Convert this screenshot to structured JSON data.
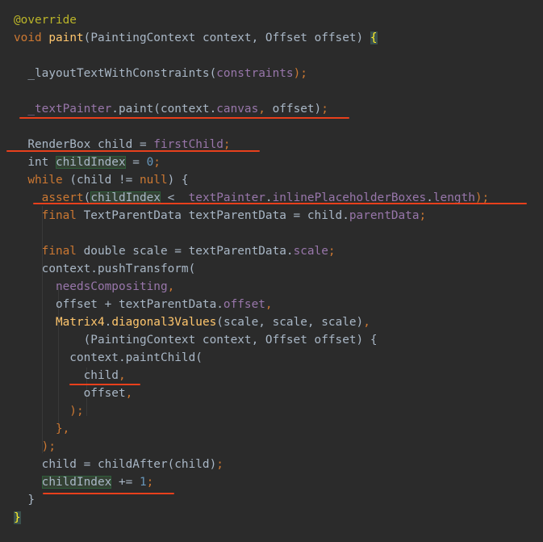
{
  "editor": {
    "lines": [
      {
        "tokens": [
          {
            "t": "@override",
            "c": "ann"
          }
        ]
      },
      {
        "tokens": [
          {
            "t": "void ",
            "c": "kw"
          },
          {
            "t": "paint",
            "c": "fn"
          },
          {
            "t": "(PaintingContext context, Offset offset) ",
            "c": "plain"
          },
          {
            "t": "{",
            "c": "brace"
          }
        ]
      },
      {
        "tokens": []
      },
      {
        "tokens": [
          {
            "t": "  _layoutTextWithConstraints(",
            "c": "plain"
          },
          {
            "t": "constraints",
            "c": "field"
          },
          {
            "t": ");",
            "c": "kw"
          }
        ]
      },
      {
        "tokens": []
      },
      {
        "tokens": [
          {
            "t": "  ",
            "c": "plain"
          },
          {
            "t": "_textPainter",
            "c": "tp"
          },
          {
            "t": ".paint(context.",
            "c": "plain"
          },
          {
            "t": "canvas",
            "c": "field"
          },
          {
            "t": ", ",
            "c": "kw"
          },
          {
            "t": "offset)",
            "c": "plain"
          },
          {
            "t": ";",
            "c": "kw"
          }
        ]
      },
      {
        "tokens": []
      },
      {
        "tokens": [
          {
            "t": "  RenderBox child = ",
            "c": "plain"
          },
          {
            "t": "firstChild",
            "c": "field"
          },
          {
            "t": ";",
            "c": "kw"
          }
        ]
      },
      {
        "tokens": [
          {
            "t": "  int ",
            "c": "plain"
          },
          {
            "t": "childIndex",
            "c": "green"
          },
          {
            "t": " = ",
            "c": "plain"
          },
          {
            "t": "0",
            "c": "num"
          },
          {
            "t": ";",
            "c": "kw"
          }
        ]
      },
      {
        "tokens": [
          {
            "t": "  while ",
            "c": "kw"
          },
          {
            "t": "(child != ",
            "c": "plain"
          },
          {
            "t": "null",
            "c": "kw"
          },
          {
            "t": ") {",
            "c": "plain"
          }
        ]
      },
      {
        "tokens": [
          {
            "t": "    ",
            "c": "plain"
          },
          {
            "t": "assert",
            "c": "kw"
          },
          {
            "t": "(",
            "c": "plain"
          },
          {
            "t": "childIndex",
            "c": "green"
          },
          {
            "t": " < ",
            "c": "plain"
          },
          {
            "t": "_textPainter",
            "c": "tp"
          },
          {
            "t": ".",
            "c": "plain"
          },
          {
            "t": "inlinePlaceholderBoxes",
            "c": "field"
          },
          {
            "t": ".",
            "c": "plain"
          },
          {
            "t": "length",
            "c": "field"
          },
          {
            "t": ");",
            "c": "kw"
          }
        ]
      },
      {
        "tokens": [
          {
            "t": "    final ",
            "c": "kw"
          },
          {
            "t": "TextParentData textParentData = child.",
            "c": "plain"
          },
          {
            "t": "parentData",
            "c": "field"
          },
          {
            "t": ";",
            "c": "kw"
          }
        ]
      },
      {
        "tokens": []
      },
      {
        "tokens": [
          {
            "t": "    final ",
            "c": "kw"
          },
          {
            "t": "double scale = textParentData.",
            "c": "plain"
          },
          {
            "t": "scale",
            "c": "field"
          },
          {
            "t": ";",
            "c": "kw"
          }
        ]
      },
      {
        "tokens": [
          {
            "t": "    context.pushTransform(",
            "c": "plain"
          }
        ]
      },
      {
        "tokens": [
          {
            "t": "      ",
            "c": "plain"
          },
          {
            "t": "needsCompositing",
            "c": "field"
          },
          {
            "t": ",",
            "c": "kw"
          }
        ]
      },
      {
        "tokens": [
          {
            "t": "      offset + textParentData.",
            "c": "plain"
          },
          {
            "t": "offset",
            "c": "field"
          },
          {
            "t": ",",
            "c": "kw"
          }
        ]
      },
      {
        "tokens": [
          {
            "t": "      ",
            "c": "plain"
          },
          {
            "t": "Matrix4",
            "c": "fn"
          },
          {
            "t": ".",
            "c": "plain"
          },
          {
            "t": "diagonal3Values",
            "c": "fn"
          },
          {
            "t": "(scale, scale, scale)",
            "c": "plain"
          },
          {
            "t": ",",
            "c": "kw"
          }
        ]
      },
      {
        "tokens": [
          {
            "t": "          (PaintingContext context, Offset offset) {",
            "c": "plain"
          }
        ]
      },
      {
        "tokens": [
          {
            "t": "        context.paintChild(",
            "c": "plain"
          }
        ]
      },
      {
        "tokens": [
          {
            "t": "          child",
            "c": "plain"
          },
          {
            "t": ",",
            "c": "kw"
          }
        ]
      },
      {
        "tokens": [
          {
            "t": "          offset",
            "c": "plain"
          },
          {
            "t": ",",
            "c": "kw"
          }
        ]
      },
      {
        "tokens": [
          {
            "t": "        );",
            "c": "kw"
          }
        ]
      },
      {
        "tokens": [
          {
            "t": "      },",
            "c": "kw"
          }
        ]
      },
      {
        "tokens": [
          {
            "t": "    );",
            "c": "kw"
          }
        ]
      },
      {
        "tokens": [
          {
            "t": "    child = childAfter(child)",
            "c": "plain"
          },
          {
            "t": ";",
            "c": "kw"
          }
        ]
      },
      {
        "tokens": [
          {
            "t": "    ",
            "c": "plain"
          },
          {
            "t": "childIndex",
            "c": "green"
          },
          {
            "t": " += ",
            "c": "plain"
          },
          {
            "t": "1",
            "c": "num"
          },
          {
            "t": ";",
            "c": "kw"
          }
        ]
      },
      {
        "tokens": [
          {
            "t": "  }",
            "c": "plain"
          }
        ]
      },
      {
        "tokens": [
          {
            "t": "}",
            "c": "brace"
          }
        ]
      }
    ]
  },
  "colors": {
    "background": "#2b2b2b",
    "annotation_underline": "#e8401c"
  }
}
